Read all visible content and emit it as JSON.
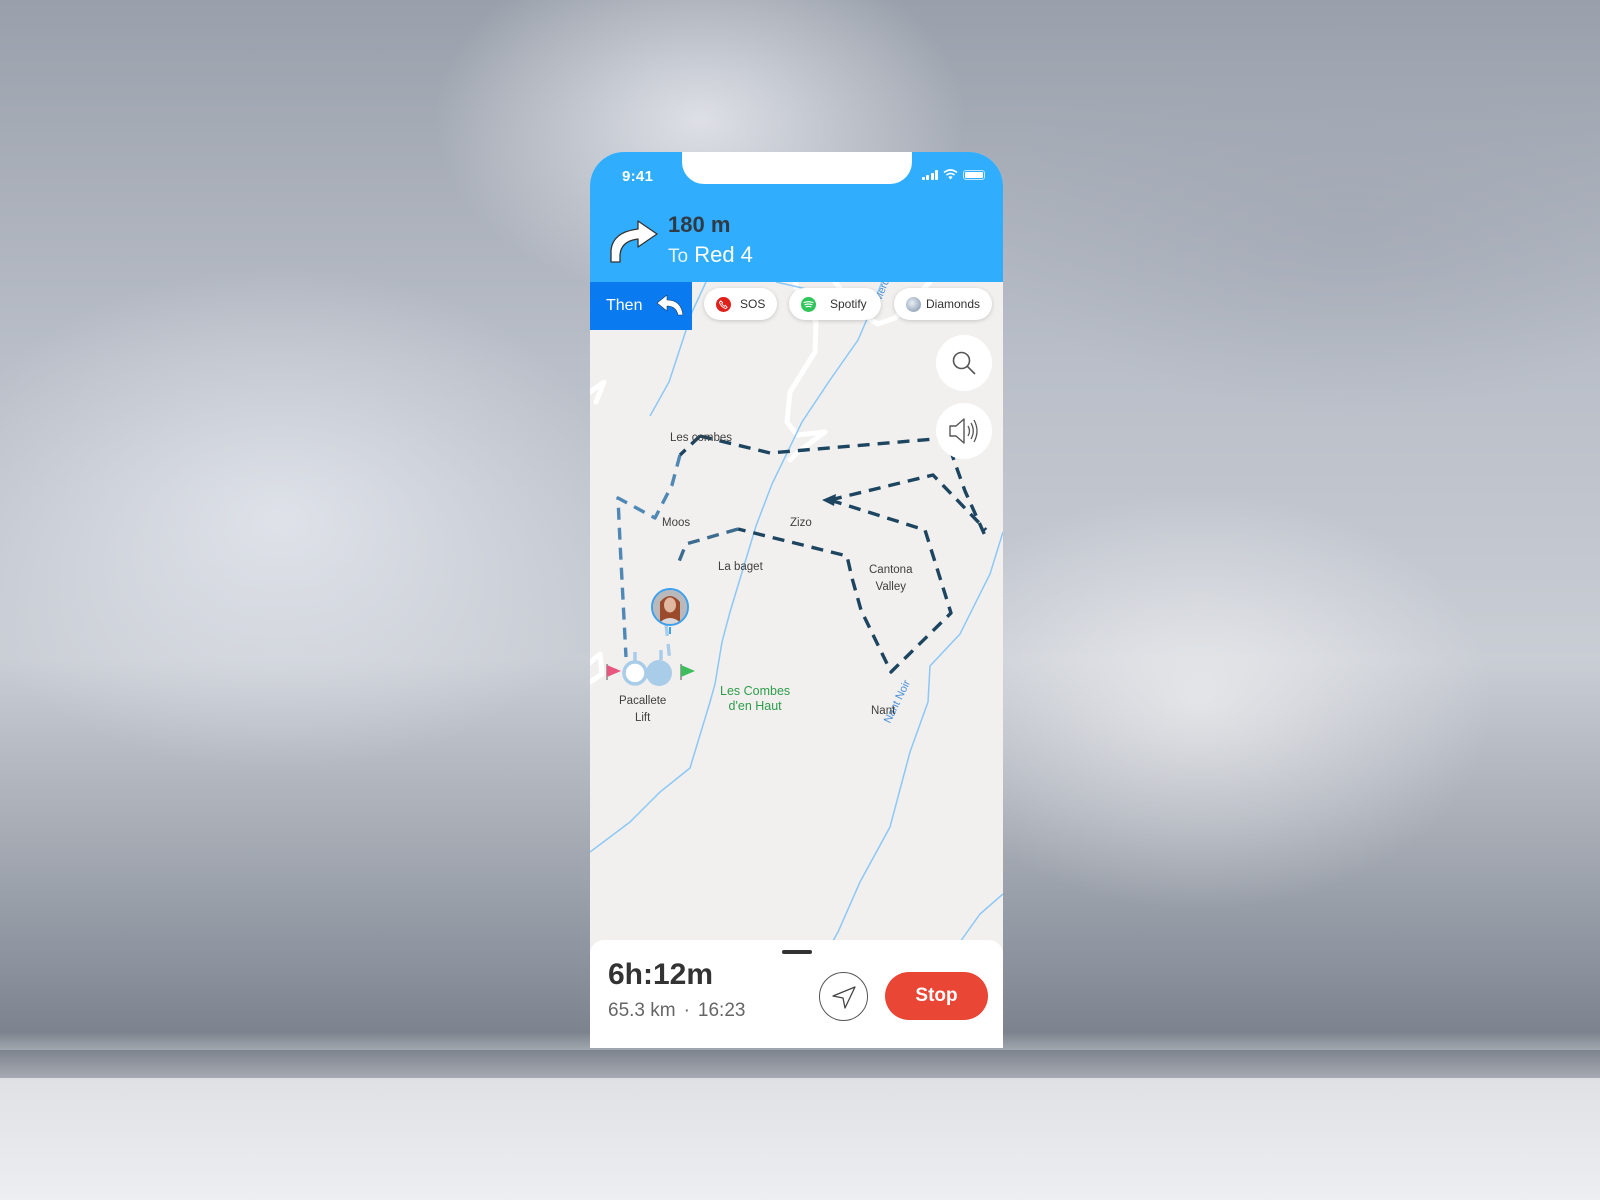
{
  "status_bar": {
    "time": "9:41"
  },
  "navigation": {
    "distance": "180 m",
    "destination_prefix": "To",
    "destination": "Red 4",
    "turn_direction": "right",
    "then_label": "Then",
    "then_direction": "left",
    "header_color": "#30adfd",
    "then_color": "#0a7af0"
  },
  "shortcuts": [
    {
      "label": "SOS",
      "icon": "phone-icon",
      "color": "#e0201a"
    },
    {
      "label": "Spotify",
      "icon": "spotify-icon",
      "color": "#2ec55a"
    },
    {
      "label": "Diamonds",
      "icon": "diamonds-avatar-icon",
      "color": "#7a8ea8"
    }
  ],
  "map": {
    "labels": {
      "les_combes": "Les combes",
      "moos": "Moos",
      "zizo": "Zizo",
      "la_baget": "La baget",
      "cantona_valley_1": "Cantona",
      "cantona_valley_2": "Valley",
      "pacallete_1": "Pacallete",
      "pacallete_2": "Lift",
      "les_combes_haut_1": "Les Combes",
      "les_combes_haut_2": "d'en Haut",
      "nant": "Nant",
      "nant_noir": "Nant Noir",
      "le_merdy": "Le Merd"
    },
    "route_color": "#1d4560",
    "route_light_color": "#4f88b4",
    "lift_color": "#a9cde8",
    "stream_color": "#8cc8f5",
    "area_label_color": "#2e9d4a",
    "start_flag_color": "#e8557e",
    "end_flag_color": "#3dbd5c"
  },
  "controls": {
    "search": "search-icon",
    "sound": "speaker-icon"
  },
  "trip": {
    "eta": "6h:12m",
    "distance": "65.3 km",
    "separator": "·",
    "arrival": "16:23",
    "stop_label": "Stop",
    "stop_color": "#e94635"
  }
}
